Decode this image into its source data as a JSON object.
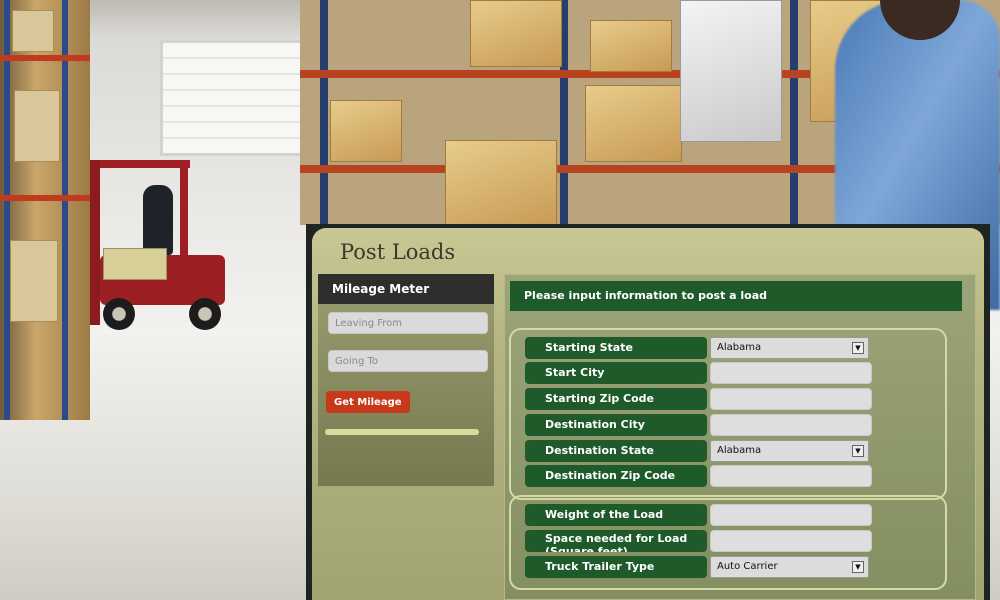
{
  "panel": {
    "title": "Post Loads"
  },
  "mileage_meter": {
    "heading": "Mileage Meter",
    "leaving_from_placeholder": "Leaving From",
    "going_to_placeholder": "Going To",
    "button_label": "Get Mileage",
    "progress": 1.0
  },
  "form": {
    "heading": "Please input information to post a load",
    "fields": [
      {
        "label": "Starting State",
        "type": "select",
        "value": "Alabama"
      },
      {
        "label": "Start City",
        "type": "text",
        "value": ""
      },
      {
        "label": "Starting Zip Code",
        "type": "text",
        "value": ""
      },
      {
        "label": "Destination City",
        "type": "text",
        "value": ""
      },
      {
        "label": "Destination State",
        "type": "select",
        "value": "Alabama"
      },
      {
        "label": "Destination Zip Code",
        "type": "text",
        "value": ""
      },
      {
        "label": "Weight of the Load",
        "type": "text",
        "value": ""
      },
      {
        "label": "Space needed for Load (Square feet)",
        "type": "text",
        "value": ""
      },
      {
        "label": "Truck Trailer Type",
        "type": "select",
        "value": "Auto Carrier"
      }
    ]
  },
  "icons": {
    "dropdown": "dropdown-arrow-icon"
  },
  "colors": {
    "label_green": "#1f5a2b",
    "button_red": "#c8381b",
    "panel_olive": "#b6b682"
  }
}
